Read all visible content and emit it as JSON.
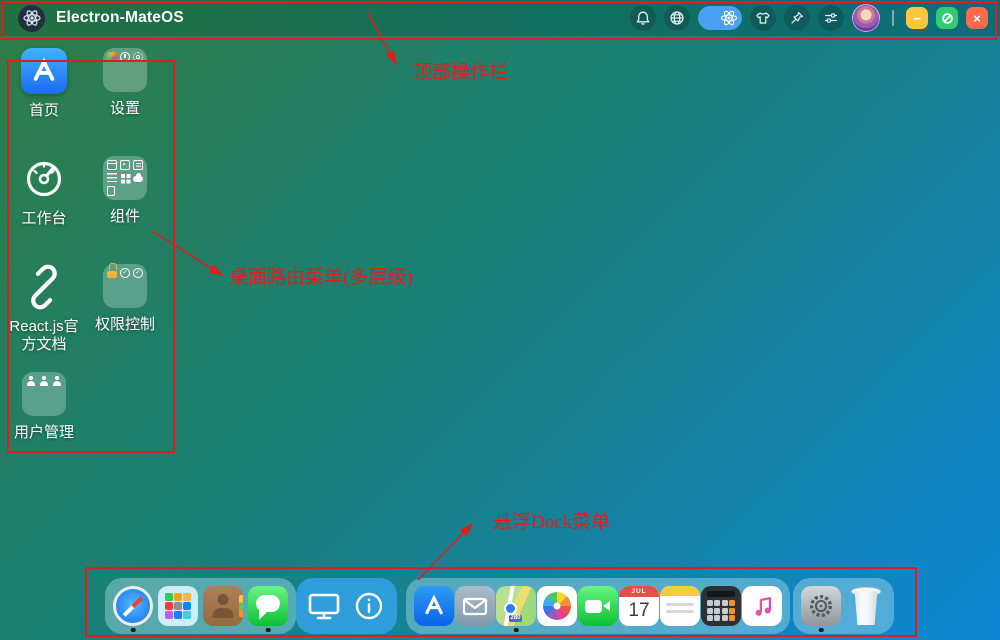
{
  "topbar": {
    "title": "Electron-MateOS",
    "logo_icon": "atom-icon",
    "action_icons": [
      "bell-icon",
      "globe-icon",
      "atom-toggle-pill",
      "tshirt-icon",
      "pin-icon",
      "sliders-icon"
    ],
    "window_controls": {
      "minimize": "−",
      "maximize_icon": "circle-slash",
      "close": "×"
    }
  },
  "desktop": {
    "icons": [
      {
        "label": "首页",
        "icon": "app-store-icon"
      },
      {
        "label": "设置",
        "icon": "folder-icon",
        "mini_icons": [
          "palette",
          "clock",
          "gear"
        ]
      },
      {
        "label": "工作台",
        "icon": "dashboard-gauge-icon"
      },
      {
        "label": "组件",
        "icon": "folder-icon",
        "mini_icons": [
          "table",
          "image",
          "document",
          "list",
          "grid",
          "cloud",
          "file"
        ]
      },
      {
        "label": "React.js官方文档",
        "icon": "link-icon"
      },
      {
        "label": "权限控制",
        "icon": "folder-icon",
        "mini_icons": [
          "lock",
          "shield-check",
          "shield-check"
        ]
      },
      {
        "label": "用户管理",
        "icon": "folder-icon",
        "mini_icons": [
          "user",
          "user",
          "user"
        ]
      }
    ]
  },
  "dock": {
    "groups": [
      {
        "items": [
          "safari",
          "launchpad",
          "contacts",
          "messages"
        ],
        "running": [
          "safari",
          "messages"
        ]
      },
      {
        "items": [
          "display",
          "info"
        ],
        "running": []
      },
      {
        "items": [
          "app-store",
          "mail",
          "maps",
          "photos",
          "facetime",
          "calendar",
          "notes",
          "calculator",
          "music"
        ],
        "running": [
          "maps"
        ]
      },
      {
        "items": [
          "system-settings",
          "trash"
        ],
        "running": [
          "system-settings"
        ]
      }
    ],
    "calendar": {
      "month": "JUL",
      "day": "17"
    },
    "maps_sign": "280"
  },
  "annotations": {
    "color": "#e11d1d",
    "items": [
      {
        "text": "顶部操作栏"
      },
      {
        "text": "桌面路由菜单(多层级)"
      },
      {
        "text": "悬浮Dock菜单"
      }
    ]
  },
  "colors": {
    "background_start": "#2f7e45",
    "background_mid": "#18807c",
    "background_end": "#0e86d7",
    "topbar_start": "#21713f",
    "topbar_end": "#0c6d79",
    "toggle_pill": "#4aa0f2",
    "btn_minimize": "#fec53f",
    "btn_maximize": "#2fcd70",
    "btn_close": "#f96a4c",
    "annotation_red": "#e11d1d"
  }
}
